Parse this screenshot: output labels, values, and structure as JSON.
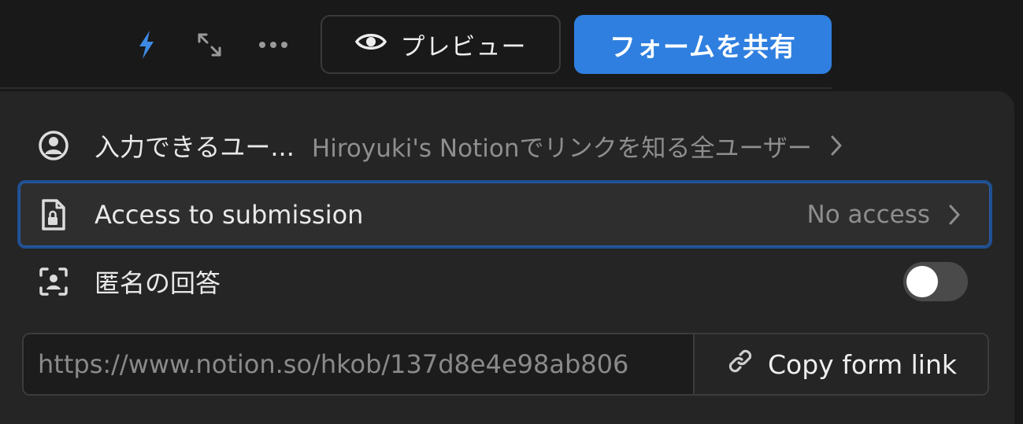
{
  "toolbar": {
    "icons": [
      "bolt-icon",
      "expand-icon",
      "more-icon"
    ],
    "preview_label": "プレビュー",
    "share_label": "フォームを共有",
    "accent_color": "#2f7fe0"
  },
  "share_panel": {
    "who_can_submit": {
      "label": "入力できるユー...",
      "value": "Hiroyuki's Notionでリンクを知る全ユーザー",
      "icon": "user-circle-icon"
    },
    "access_to_submission": {
      "label": "Access to submission",
      "value": "No access",
      "icon": "locked-document-icon"
    },
    "anonymous": {
      "label": "匿名の回答",
      "icon": "anonymous-user-icon",
      "enabled": false
    },
    "link": {
      "url": "https://www.notion.so/hkob/137d8e4e98ab806",
      "copy_label": "Copy form link",
      "icon": "link-icon"
    }
  }
}
